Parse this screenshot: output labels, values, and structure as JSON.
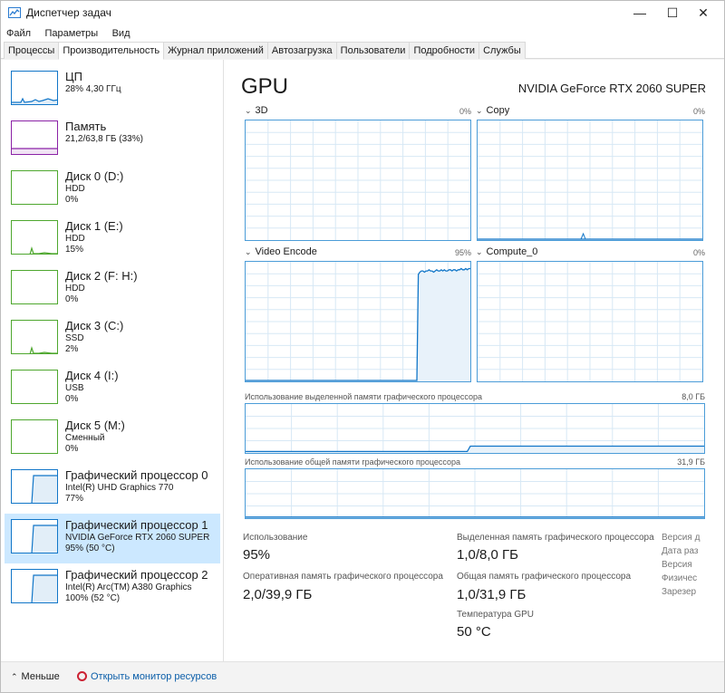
{
  "window": {
    "title": "Диспетчер задач",
    "minimize": "—",
    "maximize": "☐",
    "close": "✕"
  },
  "menu": [
    "Файл",
    "Параметры",
    "Вид"
  ],
  "tabs": [
    "Процессы",
    "Производительность",
    "Журнал приложений",
    "Автозагрузка",
    "Пользователи",
    "Подробности",
    "Службы"
  ],
  "active_tab": "Производительность",
  "sidebar": {
    "items": [
      {
        "name": "ЦП",
        "line1": "28% 4,30 ГГц",
        "line2": "",
        "kind": "cpu",
        "color": "#1176c8"
      },
      {
        "name": "Память",
        "line1": "21,2/63,8 ГБ (33%)",
        "line2": "",
        "kind": "memory",
        "color": "#8b22a6"
      },
      {
        "name": "Диск 0 (D:)",
        "line1": "HDD",
        "line2": "0%",
        "kind": "disk",
        "color": "#4ea72e"
      },
      {
        "name": "Диск 1 (E:)",
        "line1": "HDD",
        "line2": "15%",
        "kind": "disk",
        "color": "#4ea72e"
      },
      {
        "name": "Диск 2 (F: H:)",
        "line1": "HDD",
        "line2": "0%",
        "kind": "disk",
        "color": "#4ea72e"
      },
      {
        "name": "Диск 3 (C:)",
        "line1": "SSD",
        "line2": "2%",
        "kind": "disk",
        "color": "#4ea72e"
      },
      {
        "name": "Диск 4 (I:)",
        "line1": "USB",
        "line2": "0%",
        "kind": "disk",
        "color": "#4ea72e"
      },
      {
        "name": "Диск 5 (M:)",
        "line1": "Сменный",
        "line2": "0%",
        "kind": "disk",
        "color": "#4ea72e"
      },
      {
        "name": "Графический процессор 0",
        "line1": "Intel(R) UHD Graphics 770",
        "line2": "77%",
        "kind": "gpu",
        "color": "#1176c8"
      },
      {
        "name": "Графический процессор 1",
        "line1": "NVIDIA GeForce RTX 2060 SUPER",
        "line2": "95% (50 °C)",
        "kind": "gpu",
        "color": "#1176c8",
        "selected": true
      },
      {
        "name": "Графический процессор 2",
        "line1": "Intel(R) Arc(TM) A380 Graphics",
        "line2": "100% (52 °C)",
        "kind": "gpu",
        "color": "#1176c8"
      }
    ]
  },
  "main": {
    "title": "GPU",
    "model": "NVIDIA GeForce RTX 2060 SUPER",
    "engines": [
      {
        "label": "3D",
        "pct": "0%"
      },
      {
        "label": "Copy",
        "pct": "0%"
      },
      {
        "label": "Video Encode",
        "pct": "95%"
      },
      {
        "label": "Compute_0",
        "pct": "0%"
      }
    ],
    "dedicated_label": "Использование выделенной памяти графического процессора",
    "dedicated_max": "8,0 ГБ",
    "shared_label": "Использование общей памяти графического процессора",
    "shared_max": "31,9 ГБ",
    "stats": {
      "usage_label": "Использование",
      "usage_value": "95%",
      "gpu_ram_label": "Оперативная память графического процессора",
      "gpu_ram_value": "2,0/39,9 ГБ",
      "dedicated_mem_label": "Выделенная память графического процессора",
      "dedicated_mem_value": "1,0/8,0 ГБ",
      "shared_mem_label": "Общая память графического процессора",
      "shared_mem_value": "1,0/31,9 ГБ",
      "temp_label": "Температура GPU",
      "temp_value": "50 °C"
    },
    "meta_labels": [
      "Версия д",
      "Дата раз",
      "Версия",
      "Физичес",
      "Зарезер"
    ]
  },
  "graph_data": {
    "video_encode": [
      0,
      0,
      0,
      0,
      0,
      0,
      0,
      0,
      0,
      0,
      0,
      0,
      0,
      0,
      0,
      0,
      0,
      0,
      0,
      0,
      0,
      0,
      0,
      0,
      0,
      0,
      0,
      0,
      0,
      0,
      0,
      0,
      0,
      0,
      0,
      0,
      0,
      0,
      0,
      0,
      0,
      0,
      0,
      0,
      0,
      0,
      0,
      0,
      0,
      0,
      0,
      0,
      0,
      0,
      0,
      0,
      0,
      0,
      0,
      0,
      0,
      0,
      0,
      0,
      0,
      0,
      0,
      0,
      0,
      0,
      0,
      0,
      0,
      0,
      0,
      0,
      0,
      0,
      0,
      0,
      0,
      0,
      0,
      0,
      0,
      0,
      0,
      0,
      0,
      0,
      0,
      0,
      0,
      0,
      0,
      0,
      0,
      0,
      0,
      0,
      0,
      0,
      0,
      0,
      0,
      0,
      0,
      0,
      0,
      0,
      0,
      0,
      0,
      90,
      92,
      93,
      93,
      92,
      93,
      93,
      94,
      93,
      93,
      92,
      93,
      94,
      93,
      93,
      94,
      93,
      94,
      93,
      93,
      94,
      94,
      93,
      94,
      94,
      93,
      94,
      94,
      95,
      94,
      94,
      95,
      94,
      95,
      95
    ],
    "copy": [
      0,
      0,
      0,
      0,
      0,
      0,
      0,
      0,
      0,
      0,
      0,
      0,
      0,
      0,
      0,
      0,
      0,
      0,
      0,
      0,
      0,
      0,
      0,
      0,
      0,
      0,
      0,
      0,
      0,
      0,
      0,
      0,
      0,
      0,
      0,
      0,
      0,
      0,
      0,
      0,
      0,
      0,
      0,
      0,
      0,
      0,
      0,
      0,
      0,
      0,
      0,
      0,
      0,
      0,
      0,
      0,
      0,
      0,
      0,
      0,
      0,
      0,
      0,
      0,
      0,
      0,
      0,
      0,
      0,
      0,
      0,
      0,
      0,
      0,
      0,
      0,
      0,
      0,
      0,
      0,
      0,
      0,
      0,
      0,
      0,
      0,
      0,
      0,
      0,
      0,
      0,
      0,
      0,
      0,
      0,
      0,
      0,
      0,
      0,
      0,
      0,
      0,
      0,
      0,
      0,
      0,
      0,
      0,
      0,
      0,
      0,
      0,
      0,
      0,
      0,
      0,
      0,
      0,
      0,
      0,
      0,
      0,
      0,
      0,
      0,
      0,
      0,
      0,
      0,
      0,
      0,
      0,
      0,
      0,
      0,
      0,
      0,
      0,
      0,
      0,
      0,
      0,
      0,
      0,
      0,
      0,
      0,
      0,
      0,
      0
    ],
    "dedicated": [
      0.1,
      0.1,
      0.1,
      0.1,
      0.1,
      0.1,
      0.1,
      0.1,
      0.1,
      0.1,
      0.1,
      0.1,
      0.1,
      0.1,
      0.1,
      0.1,
      0.1,
      0.1,
      0.1,
      0.1,
      0.1,
      0.1,
      0.1,
      0.1,
      0.1,
      0.1,
      0.1,
      0.1,
      0.1,
      0.1,
      0.1,
      0.1,
      0.1,
      0.1,
      0.1,
      0.1,
      0.1,
      0.1,
      0.1,
      0.1,
      0.1,
      0.1,
      0.1,
      0.1,
      0.1,
      0.1,
      0.1,
      0.1,
      0.1,
      0.1,
      0.1,
      0.1,
      0.1,
      0.1,
      0.1,
      0.1,
      0.1,
      0.1,
      0.1,
      0.1,
      0.1,
      0.1,
      0.1,
      0.1,
      0.1,
      0.1,
      0.1,
      0.1,
      0.1,
      0.1,
      0.1,
      0.1,
      0.1,
      0.1,
      1.0,
      1.0,
      1.0,
      1.0,
      1.0,
      1.0,
      1.0,
      1.0,
      1.0,
      1.0,
      1.0,
      1.0,
      1.0,
      1.0,
      1.0,
      1.0,
      1.0,
      1.0,
      1.0,
      1.0,
      1.0,
      1.0,
      1.0,
      1.0,
      1.0,
      1.0,
      1.0,
      1.0,
      1.0,
      1.0,
      1.0,
      1.0,
      1.0,
      1.0,
      1.0,
      1.0,
      1.0,
      1.0,
      1.0,
      1.0,
      1.0,
      1.0,
      1.0,
      1.0,
      1.0,
      1.0,
      1.0,
      1.0,
      1.0,
      1.0,
      1.0,
      1.0,
      1.0,
      1.0,
      1.0,
      1.0,
      1.0,
      1.0,
      1.0,
      1.0,
      1.0,
      1.0,
      1.0,
      1.0,
      1.0,
      1.0,
      1.0,
      1.0,
      1.0,
      1.0,
      1.0,
      1.0,
      1.0,
      1.0,
      1.0,
      1.0,
      1.0,
      1.0
    ],
    "shared": [
      0.1,
      0.1,
      0.1,
      0.1,
      0.1,
      0.1,
      0.1,
      0.1,
      0.1,
      0.1,
      0.1,
      0.1,
      0.1,
      0.1,
      0.1,
      0.1,
      0.1,
      0.1,
      0.1,
      0.1,
      0.1,
      0.1,
      0.1,
      0.1,
      0.1,
      0.1,
      0.1,
      0.1,
      0.1,
      0.1,
      0.1,
      0.1,
      0.1,
      0.1,
      0.1,
      0.1,
      0.1,
      0.1,
      0.1,
      0.1,
      0.1,
      0.1,
      0.1,
      0.1,
      0.1,
      0.1,
      0.1,
      0.1,
      0.1,
      0.1,
      0.1,
      0.1,
      0.1,
      0.1,
      0.1,
      0.1,
      0.1,
      0.1,
      0.1,
      0.1,
      0.1,
      0.1,
      0.1,
      0.1,
      0.1,
      0.1,
      0.1,
      0.1,
      0.1,
      0.1,
      0.1,
      0.1,
      0.1,
      0.1,
      0.1,
      0.1,
      0.1,
      0.1,
      0.1,
      0.1,
      0.1,
      0.1,
      0.1,
      0.1,
      0.1,
      0.1,
      0.1,
      0.1,
      0.1,
      0.1,
      0.1,
      0.1,
      0.1,
      0.1,
      0.1,
      0.1,
      0.1,
      0.1,
      0.1,
      0.1,
      0.1,
      0.1,
      0.1,
      0.1,
      0.1,
      0.1,
      0.1,
      0.1,
      0.1,
      0.1,
      0.1,
      0.1,
      0.1,
      0.1,
      0.1,
      0.1,
      0.1,
      0.1,
      0.1,
      0.1,
      0.1,
      0.1,
      0.1,
      0.1,
      0.1,
      0.1,
      0.1,
      0.1,
      0.1,
      0.1,
      0.1,
      0.1,
      0.1,
      0.1,
      0.1,
      0.1,
      0.1,
      0.1,
      0.1,
      0.1,
      0.1,
      0.1,
      0.1,
      0.1,
      0.1,
      0.1,
      0.1,
      0.1,
      0.1,
      0.1
    ]
  },
  "footer": {
    "less_label": "Меньше",
    "monitor_link": "Открыть монитор ресурсов"
  },
  "colors": {
    "accent": "#1176c8",
    "graph_border": "#4b9cd8",
    "graph_fill": "#e8f2fa",
    "grid": "#d7e8f5",
    "selected_bg": "#cce8ff"
  }
}
